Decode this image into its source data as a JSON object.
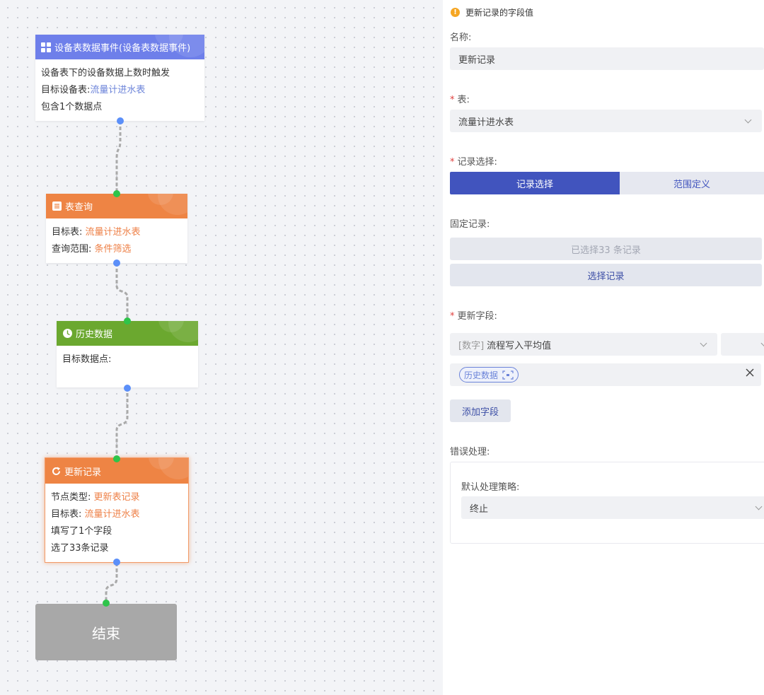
{
  "flow": {
    "node_event": {
      "title": "设备表数据事件(设备表数据事件)",
      "line1": "设备表下的设备数据上数时触发",
      "line2_label": "目标设备表:",
      "line2_value": "流量计进水表",
      "line3": "包含1个数据点"
    },
    "node_query": {
      "title": "表查询",
      "line1_label": "目标表: ",
      "line1_value": "流量计进水表",
      "line2_label": "查询范围: ",
      "line2_value": "条件筛选"
    },
    "node_history": {
      "title": "历史数据",
      "line1": "目标数据点:"
    },
    "node_update": {
      "title": "更新记录",
      "line1_label": "节点类型: ",
      "line1_value": "更新表记录",
      "line2_label": "目标表: ",
      "line2_value": "流量计进水表",
      "line3": "填写了1个字段",
      "line4": "选了33条记录"
    },
    "end_label": "结束"
  },
  "panel": {
    "warning": "更新记录的字段值",
    "name_label": "名称:",
    "name_value": "更新记录",
    "table_label": "表:",
    "table_value": "流量计进水表",
    "record_select_label": "记录选择:",
    "record_tabs": [
      "记录选择",
      "范围定义"
    ],
    "fixed_label": "固定记录:",
    "selected_info": "已选择33 条记录",
    "select_button": "选择记录",
    "update_fields_label": "更新字段:",
    "field_type": "[数字]",
    "field_name": "流程写入平均值",
    "field_tag": "历史数据",
    "add_field_button": "添加字段",
    "error_label": "错误处理:",
    "strategy_label": "默认处理策略:",
    "strategy_value": "终止",
    "required_mark": "*"
  },
  "colors": {
    "event_header": "#6e7fea",
    "query_header": "#ee8444",
    "history_header": "#6ba82f",
    "update_header": "#ee8444",
    "primary": "#4154be",
    "port_out": "#5b8ff9",
    "port_in": "#2ec44a"
  },
  "icons": [
    "grid-icon",
    "table-icon",
    "clock-icon",
    "refresh-icon",
    "warning-icon",
    "chevron-down-icon",
    "close-icon",
    "scan-icon"
  ]
}
